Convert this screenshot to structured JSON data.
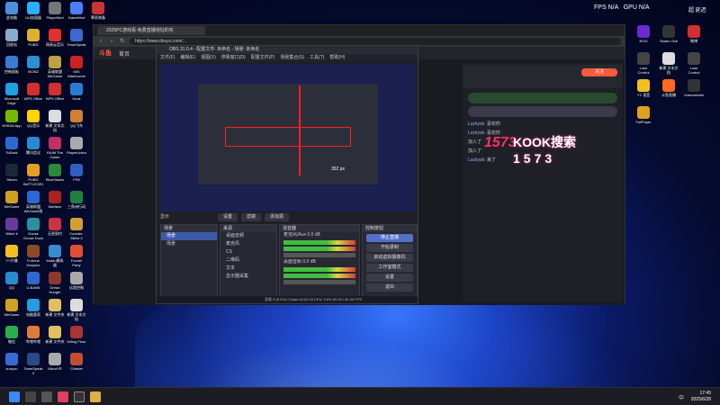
{
  "desktop": {
    "left_icons": [
      {
        "label": "此电脑",
        "color": "#4a90e2"
      },
      {
        "label": "UU加速器",
        "color": "#2bb0ff"
      },
      {
        "label": "PlayerMod",
        "color": "#777777"
      },
      {
        "label": "GameMod",
        "color": "#4a7dff"
      },
      {
        "label": "罪恶装备",
        "color": "#cc3333"
      },
      {
        "label": "回收站",
        "color": "#88aacc"
      },
      {
        "label": "PUBG",
        "color": "#e0b030"
      },
      {
        "label": "网易云音乐",
        "color": "#e03030"
      },
      {
        "label": "TeamSpeak",
        "color": "#3a6ad0"
      },
      {
        "label": "",
        "color": "#3a6ad0"
      },
      {
        "label": "控制面板",
        "color": "#3a7ad0"
      },
      {
        "label": "iSONZ",
        "color": "#2a90d0"
      },
      {
        "label": "英雄联盟WeGame",
        "color": "#c0a040"
      },
      {
        "label": "MSI Afterburner",
        "color": "#cc2222"
      },
      {
        "label": "",
        "color": "#cc2222"
      },
      {
        "label": "Microsoft Edge",
        "color": "#1fa0e0"
      },
      {
        "label": "WPS Office",
        "color": "#d03030"
      },
      {
        "label": "WPS Office",
        "color": "#d03030"
      },
      {
        "label": "Kook",
        "color": "#2a7ad0"
      },
      {
        "label": "",
        "color": "#2a7ad0"
      },
      {
        "label": "NVIDIA App",
        "color": "#76b900"
      },
      {
        "label": "QQ音乐",
        "color": "#ffd300"
      },
      {
        "label": "新建 文本文档",
        "color": "#dddddd"
      },
      {
        "label": "QQ飞车",
        "color": "#d08030"
      },
      {
        "label": "",
        "color": "#d08030"
      },
      {
        "label": "ToDesk",
        "color": "#2a6ad0"
      },
      {
        "label": "腾讯会议",
        "color": "#2a8ad0"
      },
      {
        "label": "RAIM The Game",
        "color": "#c03060"
      },
      {
        "label": "PlayerUnknown",
        "color": "#aaaaaa"
      },
      {
        "label": "",
        "color": "#aaaaaa"
      },
      {
        "label": "Steam",
        "color": "#1b2838"
      },
      {
        "label": "PUBG BATTLEGROUNDS",
        "color": "#e0a020"
      },
      {
        "label": "BlueStacks",
        "color": "#2a8a3a"
      },
      {
        "label": "PS5",
        "color": "#3060c0"
      },
      {
        "label": "",
        "color": "#3060c0"
      },
      {
        "label": "WeGame",
        "color": "#d0a020"
      },
      {
        "label": "英雄联盟WeGame版",
        "color": "#2a6ad0"
      },
      {
        "label": "Warface",
        "color": "#aa2222"
      },
      {
        "label": "三角洲行动",
        "color": "#208040"
      },
      {
        "label": "",
        "color": "#208040"
      },
      {
        "label": "Witch It",
        "color": "#6a3a9a"
      },
      {
        "label": "Goose Goose Duck",
        "color": "#2a90a0"
      },
      {
        "label": "无畏契约",
        "color": "#cc3344"
      },
      {
        "label": "Counter-Strike 2",
        "color": "#d0a030"
      },
      {
        "label": "",
        "color": "#d0a030"
      },
      {
        "label": "YY开播",
        "color": "#f0c020"
      },
      {
        "label": "Fortune Keepers",
        "color": "#8a4a2a"
      },
      {
        "label": "MuMu模拟器",
        "color": "#3a8ad0"
      },
      {
        "label": "Funnel Party",
        "color": "#e05030"
      },
      {
        "label": "",
        "color": "#e05030"
      },
      {
        "label": "QQ",
        "color": "#2a8ad0"
      },
      {
        "label": "U-BANK",
        "color": "#2a6ad0"
      },
      {
        "label": "Dread Hunger",
        "color": "#8a3a2a"
      },
      {
        "label": "远程控制",
        "color": "#aaaaaa"
      },
      {
        "label": "",
        "color": "#aaaaaa"
      },
      {
        "label": "WeGame",
        "color": "#d0a020"
      },
      {
        "label": "电脑管家",
        "color": "#2a9ae0"
      },
      {
        "label": "新建 文件夹",
        "color": "#e0c060"
      },
      {
        "label": "新建 文本文档",
        "color": "#dddddd"
      },
      {
        "label": "",
        "color": "#dddddd"
      },
      {
        "label": "微信",
        "color": "#2aae4a"
      },
      {
        "label": "哔哩哔哩",
        "color": "#e07a3a"
      },
      {
        "label": "新建 文件夹",
        "color": "#e0c060"
      },
      {
        "label": "Killing Floor",
        "color": "#aa3333"
      },
      {
        "label": "",
        "color": "#aa3333"
      },
      {
        "label": "sunyou",
        "color": "#3a6ad0"
      },
      {
        "label": "TeamSpeak 3",
        "color": "#2a4a8a"
      },
      {
        "label": "MicroVR",
        "color": "#aaaaaa"
      },
      {
        "label": "Climber",
        "color": "#c05030"
      }
    ],
    "right_icons": [
      {
        "label": "ROG",
        "color": "#6a2ad0"
      },
      {
        "label": "Studio One",
        "color": "#333333"
      },
      {
        "label": "微博",
        "color": "#d03030"
      },
      {
        "label": "Lose Control",
        "color": "#444444"
      },
      {
        "label": "新建 文本文档",
        "color": "#dddddd"
      },
      {
        "label": "Lose Control",
        "color": "#444444"
      },
      {
        "label": "YY 语音",
        "color": "#f0c020"
      },
      {
        "label": "斗鱼直播",
        "color": "#ff6a20"
      },
      {
        "label": "Voicemeeter",
        "color": "#333333"
      },
      {
        "label": "FullPaper",
        "color": "#e0a020"
      }
    ]
  },
  "overlay": {
    "fps_label": "FPS",
    "fps_value": "N/A",
    "gpu_label": "GPU",
    "gpu_value": "N/A",
    "right_text": "超 延迟"
  },
  "browser": {
    "tab_title": "2025PC游戏看-免费直播地址的实",
    "url": "https://www.douyu.com/...",
    "site_logo": "斗鱼",
    "site_nav": "首页",
    "follow_label": "关注",
    "chat": [
      {
        "user": "Luckysk:",
        "text": "喜欢你"
      },
      {
        "user": "Luckysk:",
        "text": "喜欢你"
      },
      {
        "user": "",
        "text": "加入了"
      },
      {
        "user": "",
        "text": "加入了"
      },
      {
        "user": "Luckysk:",
        "text": "来了"
      }
    ],
    "kook_line1": "KOOK搜索",
    "kook_line2": "1573",
    "logo_text": "1573"
  },
  "obs": {
    "title": "OBS 31.0.4 - 配置文件: 未命名 - 场景: 未命名",
    "menu": [
      "文件(F)",
      "编辑(E)",
      "视图(V)",
      "停靠窗口(D)",
      "配置文件(P)",
      "场景集合(S)",
      "工具(T)",
      "帮助(H)"
    ],
    "preview_size_label": "352 px",
    "source_label": "显示",
    "tools": [
      "设置",
      "滤镜",
      "添加源"
    ],
    "scenes_title": "场景",
    "scenes": [
      "场景",
      "场景"
    ],
    "sources_title": "来源",
    "sources": [
      "桌面音频",
      "麦克风",
      "CS",
      "二维码",
      "文本",
      "显示器采集"
    ],
    "mixer_title": "混音器",
    "mixer": [
      {
        "label": "麦克风/Aux",
        "db": "0.0 dB"
      },
      {
        "label": "桌面音频",
        "db": "0.0 dB"
      }
    ],
    "controls_title": "控制按钮",
    "controls": [
      "停止直播",
      "开始录制",
      "启动虚拟摄像机",
      "工作室模式",
      "设置",
      "退出"
    ],
    "status": "丢帧 0 (0.0%)   0 kbps   00:02:15   CPU: 0.6%   60.00 / 60.00 FPS"
  },
  "taskbar": {
    "tray": "中",
    "time": "17:45",
    "date": "2025/6/28"
  }
}
